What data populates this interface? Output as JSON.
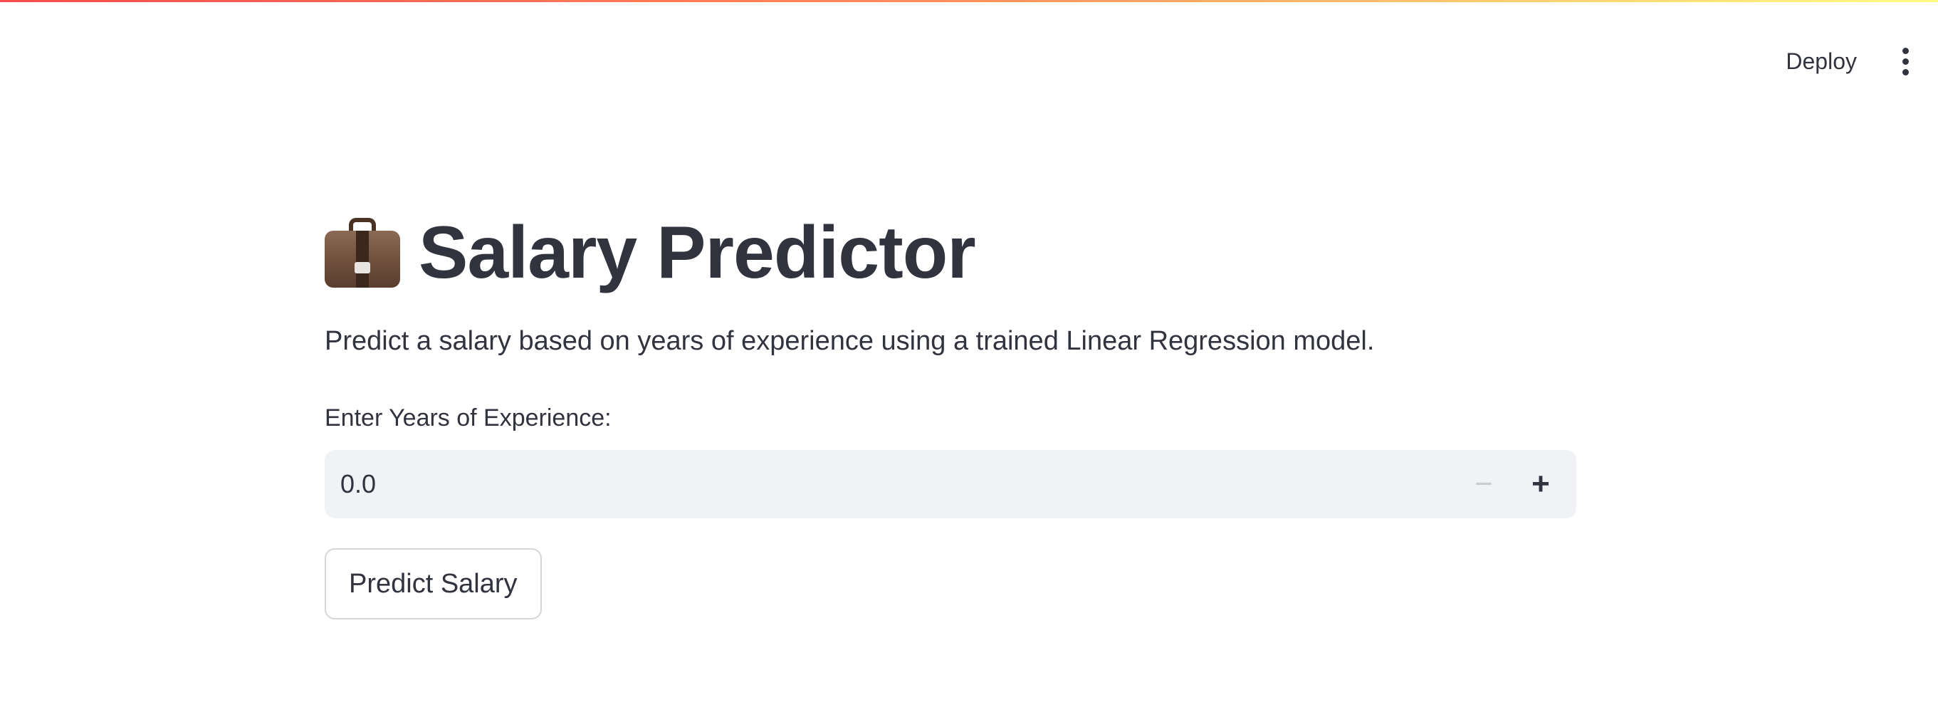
{
  "header": {
    "deploy_label": "Deploy",
    "menu_icon": "vertical-ellipsis-icon"
  },
  "main": {
    "title_icon": "briefcase-icon",
    "title": "Salary Predictor",
    "subtitle": "Predict a salary based on years of experience using a trained Linear Regression model.",
    "input": {
      "label": "Enter Years of Experience:",
      "value": "0.0",
      "decrement_icon": "minus-icon",
      "increment_icon": "plus-icon",
      "decrement_symbol": "−",
      "increment_symbol": "+"
    },
    "predict_button_label": "Predict Salary"
  },
  "colors": {
    "text": "#31333f",
    "input_background": "#f0f2f6",
    "top_gradient_start": "#ff4b4b",
    "top_gradient_end": "#fffd80"
  }
}
